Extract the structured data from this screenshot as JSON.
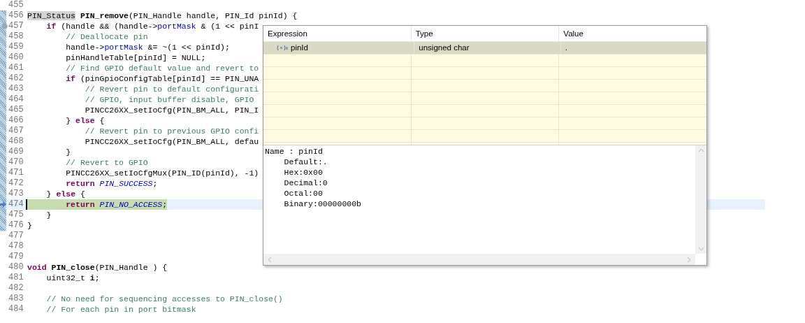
{
  "editor": {
    "lines": [
      {
        "number": "455",
        "in_range": false,
        "current": false,
        "breakpoint": false
      },
      {
        "number": "456",
        "in_range": true,
        "current": false,
        "breakpoint": false,
        "segments": [
          {
            "kind": "marked",
            "text": "PIN_Status"
          },
          {
            "kind": "bold",
            "text": " PIN_remove"
          },
          {
            "kind": "plain",
            "text": "(PIN_Handle handle, PIN_Id pinId) {"
          }
        ]
      },
      {
        "number": "457",
        "in_range": true,
        "current": false,
        "breakpoint": true,
        "segments": [
          {
            "kind": "keyword",
            "text": "    if"
          },
          {
            "kind": "plain",
            "text": " (handle && (handle->"
          },
          {
            "kind": "field",
            "text": "portMask"
          },
          {
            "kind": "plain",
            "text": " & (1 << pinI"
          }
        ]
      },
      {
        "number": "458",
        "in_range": true,
        "current": false,
        "breakpoint": false,
        "segments": [
          {
            "kind": "comment",
            "text": "        // Deallocate pin"
          }
        ]
      },
      {
        "number": "459",
        "in_range": true,
        "current": false,
        "breakpoint": false,
        "segments": [
          {
            "kind": "plain",
            "text": "        handle->"
          },
          {
            "kind": "field",
            "text": "portMask"
          },
          {
            "kind": "plain",
            "text": " &= ~(1 << pinId);"
          }
        ]
      },
      {
        "number": "460",
        "in_range": true,
        "current": false,
        "breakpoint": false,
        "segments": [
          {
            "kind": "plain",
            "text": "        pinHandleTable[pinId] = NULL;"
          }
        ]
      },
      {
        "number": "461",
        "in_range": true,
        "current": false,
        "breakpoint": false,
        "segments": [
          {
            "kind": "comment",
            "text": "        // Find GPIO default value and revert to"
          }
        ]
      },
      {
        "number": "462",
        "in_range": true,
        "current": false,
        "breakpoint": false,
        "segments": [
          {
            "kind": "keyword",
            "text": "        if"
          },
          {
            "kind": "plain",
            "text": " (pinGpioConfigTable[pinId] == PIN_UNA"
          }
        ]
      },
      {
        "number": "463",
        "in_range": true,
        "current": false,
        "breakpoint": false,
        "segments": [
          {
            "kind": "comment",
            "text": "            // Revert pin to default configurati"
          }
        ]
      },
      {
        "number": "464",
        "in_range": true,
        "current": false,
        "breakpoint": false,
        "segments": [
          {
            "kind": "comment",
            "text": "            // GPIO, input buffer disable, GPIO"
          }
        ]
      },
      {
        "number": "465",
        "in_range": true,
        "current": false,
        "breakpoint": false,
        "segments": [
          {
            "kind": "plain",
            "text": "            PINCC26XX_setIoCfg(PIN_BM_ALL, PIN_I"
          }
        ]
      },
      {
        "number": "466",
        "in_range": true,
        "current": false,
        "breakpoint": false,
        "segments": [
          {
            "kind": "plain",
            "text": "        } "
          },
          {
            "kind": "keyword",
            "text": "else"
          },
          {
            "kind": "plain",
            "text": " {"
          }
        ]
      },
      {
        "number": "467",
        "in_range": true,
        "current": false,
        "breakpoint": false,
        "segments": [
          {
            "kind": "comment",
            "text": "            // Revert pin to previous GPIO confi"
          }
        ]
      },
      {
        "number": "468",
        "in_range": true,
        "current": false,
        "breakpoint": false,
        "segments": [
          {
            "kind": "plain",
            "text": "            PINCC26XX_setIoCfg(PIN_BM_ALL, defau"
          }
        ]
      },
      {
        "number": "469",
        "in_range": true,
        "current": false,
        "breakpoint": false,
        "segments": [
          {
            "kind": "plain",
            "text": "        }"
          }
        ]
      },
      {
        "number": "470",
        "in_range": true,
        "current": false,
        "breakpoint": false,
        "segments": [
          {
            "kind": "comment",
            "text": "        // Revert to GPIO"
          }
        ]
      },
      {
        "number": "471",
        "in_range": true,
        "current": false,
        "breakpoint": false,
        "segments": [
          {
            "kind": "plain",
            "text": "        PINCC26XX_setIoCfgMux(PIN_ID(pinId), -1)"
          }
        ]
      },
      {
        "number": "472",
        "in_range": true,
        "current": false,
        "breakpoint": false,
        "segments": [
          {
            "kind": "keyword",
            "text": "        return "
          },
          {
            "kind": "constant",
            "text": "PIN_SUCCESS"
          },
          {
            "kind": "plain",
            "text": ";"
          }
        ]
      },
      {
        "number": "473",
        "in_range": true,
        "current": false,
        "breakpoint": false,
        "segments": [
          {
            "kind": "plain",
            "text": "    } "
          },
          {
            "kind": "keyword",
            "text": "else"
          },
          {
            "kind": "plain",
            "text": " {"
          }
        ]
      },
      {
        "number": "474",
        "in_range": true,
        "current": true,
        "breakpoint": false,
        "segments": [
          {
            "kind": "keyword",
            "text": "        return "
          },
          {
            "kind": "constant",
            "text": "PIN_NO_ACCESS"
          },
          {
            "kind": "plain",
            "text": ";"
          }
        ]
      },
      {
        "number": "475",
        "in_range": true,
        "current": false,
        "breakpoint": false,
        "segments": [
          {
            "kind": "plain",
            "text": "    }"
          }
        ]
      },
      {
        "number": "476",
        "in_range": true,
        "current": false,
        "breakpoint": false,
        "segments": [
          {
            "kind": "plain",
            "text": "}"
          }
        ]
      },
      {
        "number": "477",
        "in_range": false,
        "current": false,
        "breakpoint": false
      },
      {
        "number": "478",
        "in_range": false,
        "current": false,
        "breakpoint": false
      },
      {
        "number": "479",
        "in_range": false,
        "current": false,
        "breakpoint": false
      },
      {
        "number": "480",
        "in_range": false,
        "current": false,
        "breakpoint": false,
        "segments": [
          {
            "kind": "keyword",
            "text": "void "
          },
          {
            "kind": "bold",
            "text": "PIN_close"
          },
          {
            "kind": "plain",
            "text": "(PIN_Handle ) {"
          }
        ]
      },
      {
        "number": "481",
        "in_range": false,
        "current": false,
        "breakpoint": false,
        "segments": [
          {
            "kind": "plain",
            "text": "    uint32_t "
          },
          {
            "kind": "bold",
            "text": "i"
          },
          {
            "kind": "plain",
            "text": ";"
          }
        ]
      },
      {
        "number": "482",
        "in_range": false,
        "current": false,
        "breakpoint": false
      },
      {
        "number": "483",
        "in_range": false,
        "current": false,
        "breakpoint": false,
        "segments": [
          {
            "kind": "comment",
            "text": "    // No need for sequencing accesses to PIN_close()"
          }
        ]
      },
      {
        "number": "484",
        "in_range": false,
        "current": false,
        "breakpoint": false,
        "segments": [
          {
            "kind": "comment",
            "text": "    // For each pin in port bitmask"
          }
        ]
      }
    ]
  },
  "expression_popup": {
    "columns": [
      "Expression",
      "Type",
      "Value"
    ],
    "rows": [
      {
        "expression": "pinId",
        "type": "unsigned char",
        "value": ".",
        "selected": true
      }
    ],
    "details": [
      "Name : pinId",
      "    Default:.",
      "    Hex:0x00",
      "    Decimal:0",
      "    Octal:00",
      "    Binary:00000000b"
    ]
  }
}
